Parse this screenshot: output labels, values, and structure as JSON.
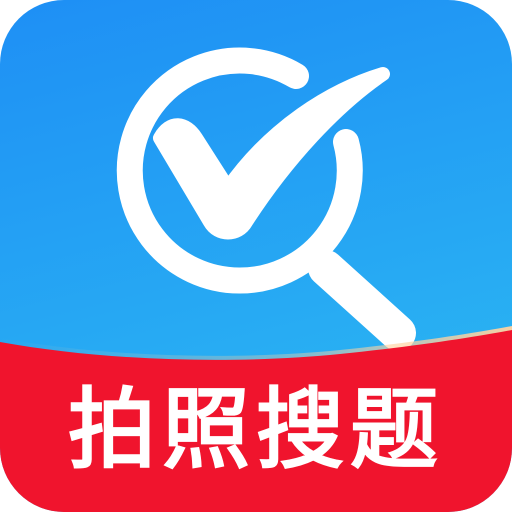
{
  "app_icon": {
    "banner_text": "拍照搜题",
    "symbol_icon": "magnifier-checkmark-icon",
    "colors": {
      "background_top": "#1E8FF5",
      "background_bottom": "#2BB6F2",
      "banner_red": "#F0142D",
      "banner_highlight": "#FFD2A0",
      "symbol": "#FFFFFF",
      "text": "#FFFFFF"
    }
  }
}
